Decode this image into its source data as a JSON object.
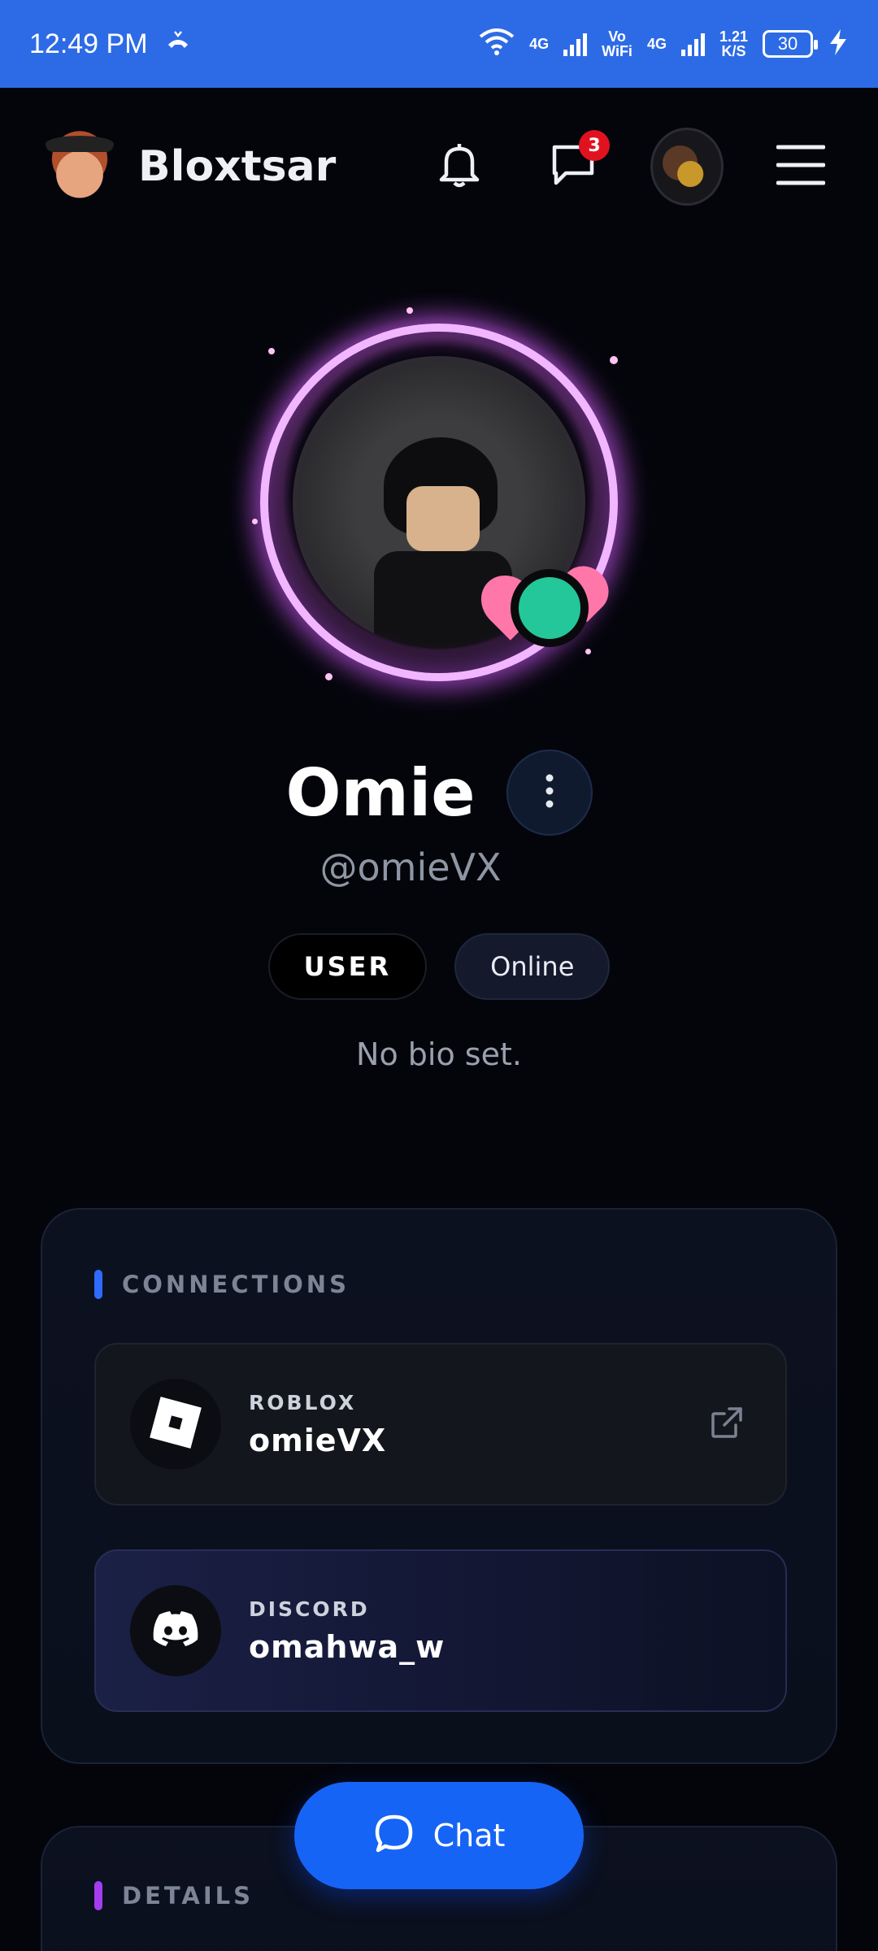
{
  "status_bar": {
    "time": "12:49 PM",
    "net1": "4G",
    "vowifi_top": "Vo",
    "vowifi_bottom": "WiFi",
    "net2": "4G",
    "speed_value": "1.21",
    "speed_unit": "K/S",
    "battery": "30"
  },
  "header": {
    "brand": "Bloxtsar",
    "messages_badge": "3"
  },
  "profile": {
    "display_name": "Omie",
    "username": "@omieVX",
    "role_chip": "USER",
    "status_chip": "Online",
    "bio": "No bio set."
  },
  "connections": {
    "title": "CONNECTIONS",
    "accent": "#2f6bff",
    "items": [
      {
        "label": "ROBLOX",
        "value": "omieVX",
        "icon": "roblox-icon"
      },
      {
        "label": "DISCORD",
        "value": "omahwa_w",
        "icon": "discord-icon"
      }
    ]
  },
  "details": {
    "title": "DETAILS",
    "accent": "#a43df0"
  },
  "chat_button": {
    "label": "Chat"
  }
}
